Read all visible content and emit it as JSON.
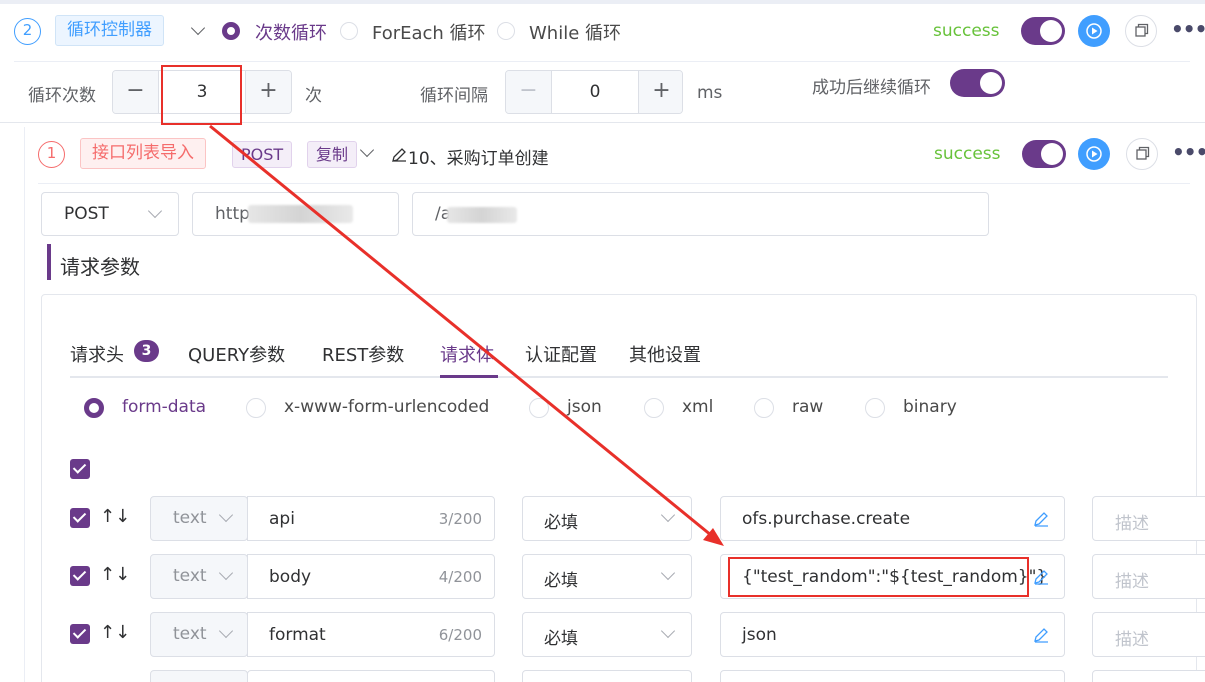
{
  "loop": {
    "index": "2",
    "title": "循环控制器",
    "modes": [
      {
        "label": "次数循环",
        "selected": true
      },
      {
        "label": "ForEach 循环",
        "selected": false
      },
      {
        "label": "While 循环",
        "selected": false
      }
    ],
    "status": "success",
    "count_label": "循环次数",
    "count_value": "3",
    "count_unit": "次",
    "interval_label": "循环间隔",
    "interval_value": "0",
    "interval_unit": "ms",
    "continue_label": "成功后继续循环",
    "minus": "−",
    "plus": "+"
  },
  "step": {
    "index": "1",
    "source_tag": "接口列表导入",
    "method_tag": "POST",
    "copy_tag": "复制",
    "name": "10、采购订单创建",
    "status": "success",
    "method_select": "POST",
    "url_host": "http",
    "url_path": "/a",
    "section_title": "请求参数"
  },
  "tabs": [
    {
      "label": "请求头",
      "badge": "3",
      "active": false
    },
    {
      "label": "QUERY参数",
      "active": false
    },
    {
      "label": "REST参数",
      "active": false
    },
    {
      "label": "请求体",
      "active": true
    },
    {
      "label": "认证配置",
      "active": false
    },
    {
      "label": "其他设置",
      "active": false
    }
  ],
  "body_types": [
    {
      "label": "form-data",
      "selected": true
    },
    {
      "label": "x-www-form-urlencoded",
      "selected": false
    },
    {
      "label": "json",
      "selected": false
    },
    {
      "label": "xml",
      "selected": false
    },
    {
      "label": "raw",
      "selected": false
    },
    {
      "label": "binary",
      "selected": false
    }
  ],
  "params": [
    {
      "type": "text",
      "key": "api",
      "count": "3/200",
      "required": "必填",
      "value": "ofs.purchase.create",
      "desc_placeholder": "描述"
    },
    {
      "type": "text",
      "key": "body",
      "count": "4/200",
      "required": "必填",
      "value": "{\"test_random\":\"${test_random}\"}",
      "desc_placeholder": "描述"
    },
    {
      "type": "text",
      "key": "format",
      "count": "6/200",
      "required": "必填",
      "value": "json",
      "desc_placeholder": "描述"
    }
  ],
  "arrows_glyph": "↑↓",
  "colors": {
    "accent": "#6a3a8a",
    "success": "#67c23a",
    "annotation": "#e8302a",
    "primary": "#409eff"
  }
}
